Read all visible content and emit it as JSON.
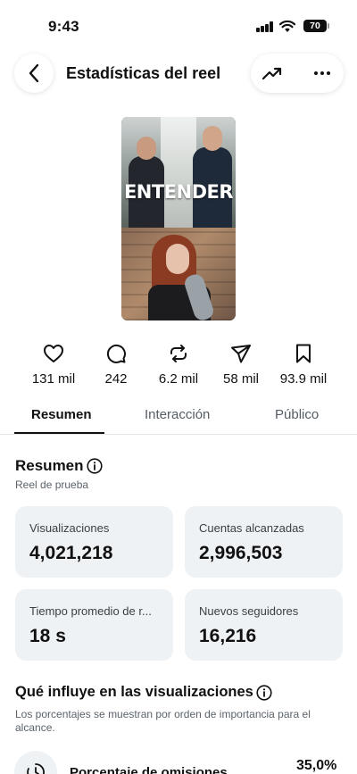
{
  "status_bar": {
    "time": "9:43",
    "battery": "70"
  },
  "header": {
    "title": "Estadísticas del reel"
  },
  "reel": {
    "caption": "ENTENDER"
  },
  "metrics": [
    {
      "icon": "heart-icon",
      "value": "131 mil"
    },
    {
      "icon": "comment-icon",
      "value": "242"
    },
    {
      "icon": "repost-icon",
      "value": "6.2 mil"
    },
    {
      "icon": "share-icon",
      "value": "58 mil"
    },
    {
      "icon": "bookmark-icon",
      "value": "93.9 mil"
    }
  ],
  "tabs": [
    {
      "label": "Resumen",
      "active": true
    },
    {
      "label": "Interacción",
      "active": false
    },
    {
      "label": "Público",
      "active": false
    }
  ],
  "summary": {
    "title": "Resumen",
    "subtitle": "Reel de prueba",
    "cards": [
      {
        "label": "Visualizaciones",
        "value": "4,021,218"
      },
      {
        "label": "Cuentas alcanzadas",
        "value": "2,996,503"
      },
      {
        "label": "Tiempo promedio de r...",
        "value": "18 s"
      },
      {
        "label": "Nuevos seguidores",
        "value": "16,216"
      }
    ]
  },
  "influence": {
    "title": "Qué influye en las visualizaciones",
    "description": "Los porcentajes se muestran por orden de importancia para el alcance.",
    "rows": [
      {
        "label": "Porcentaje de omisiones",
        "value": "35,0%"
      }
    ]
  },
  "colors": {
    "card_bg": "#eff2f5",
    "text_primary": "#111111",
    "text_secondary": "#5c636a"
  }
}
